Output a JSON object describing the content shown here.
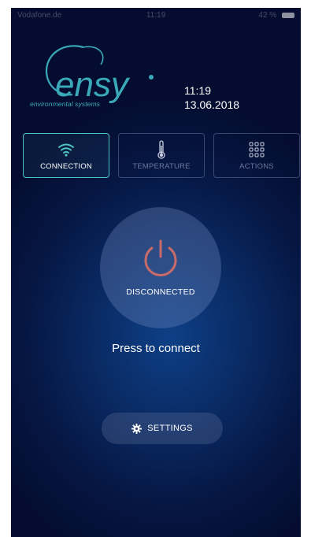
{
  "status_bar": {
    "carrier": "Vodafone.de",
    "time": "11:19",
    "battery": "42 %"
  },
  "logo": {
    "brand": "ensy",
    "tagline": "environmental systems"
  },
  "datetime": {
    "time": "11:19",
    "date": "13.06.2018"
  },
  "tabs": [
    {
      "label": "CONNECTION",
      "icon": "wifi-icon",
      "active": true
    },
    {
      "label": "TEMPERATURE",
      "icon": "thermometer-icon",
      "active": false
    },
    {
      "label": "ACTIONS",
      "icon": "grid-icon",
      "active": false
    }
  ],
  "power": {
    "status": "DISCONNECTED",
    "icon": "power-icon",
    "icon_color": "#c96a6a"
  },
  "prompt": "Press to connect",
  "settings": {
    "label": "SETTINGS",
    "icon": "gear-icon"
  },
  "colors": {
    "accent": "#4fc5c1",
    "brand_text": "#3aa9b8",
    "background": "#061744"
  }
}
